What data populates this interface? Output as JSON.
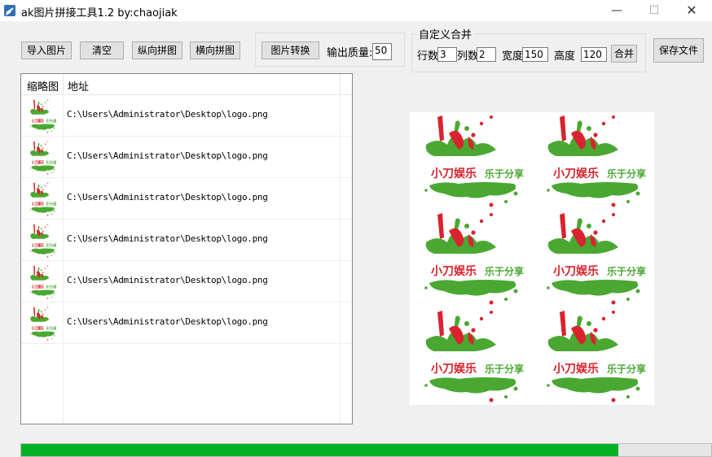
{
  "window": {
    "title": "ak图片拼接工具1.2  by:chaojiak",
    "minimize_glyph": "—",
    "maximize_glyph": "☐",
    "close_glyph": "✕"
  },
  "toolbar": {
    "import_label": "导入图片",
    "clear_label": "清空",
    "vertical_label": "纵向拼图",
    "horizontal_label": "横向拼图",
    "convert_label": "图片转换",
    "quality_label": "输出质量:",
    "quality_value": "50",
    "save_label": "保存文件"
  },
  "custom_merge": {
    "title": "自定义合并",
    "rows_label": "行数",
    "rows_value": "3",
    "cols_label": "列数",
    "cols_value": "2",
    "width_label": "宽度",
    "width_value": "150",
    "height_label": "高度",
    "height_value": "120",
    "merge_label": "合并"
  },
  "file_list": {
    "columns": [
      "缩略图",
      "地址"
    ],
    "rows": [
      {
        "path": "C:\\Users\\Administrator\\Desktop\\logo.png"
      },
      {
        "path": "C:\\Users\\Administrator\\Desktop\\logo.png"
      },
      {
        "path": "C:\\Users\\Administrator\\Desktop\\logo.png"
      },
      {
        "path": "C:\\Users\\Administrator\\Desktop\\logo.png"
      },
      {
        "path": "C:\\Users\\Administrator\\Desktop\\logo.png"
      },
      {
        "path": "C:\\Users\\Administrator\\Desktop\\logo.png"
      }
    ]
  },
  "preview": {
    "logo_text": "小刀娱乐 乐于分享",
    "tile_count": 6
  },
  "progress": {
    "percent": 86.5,
    "color": "#06b025"
  },
  "colors": {
    "logo_red": "#d9232e",
    "logo_green": "#4aa832"
  },
  "icons": {
    "app": "app-icon",
    "logo": "splash-logo"
  }
}
